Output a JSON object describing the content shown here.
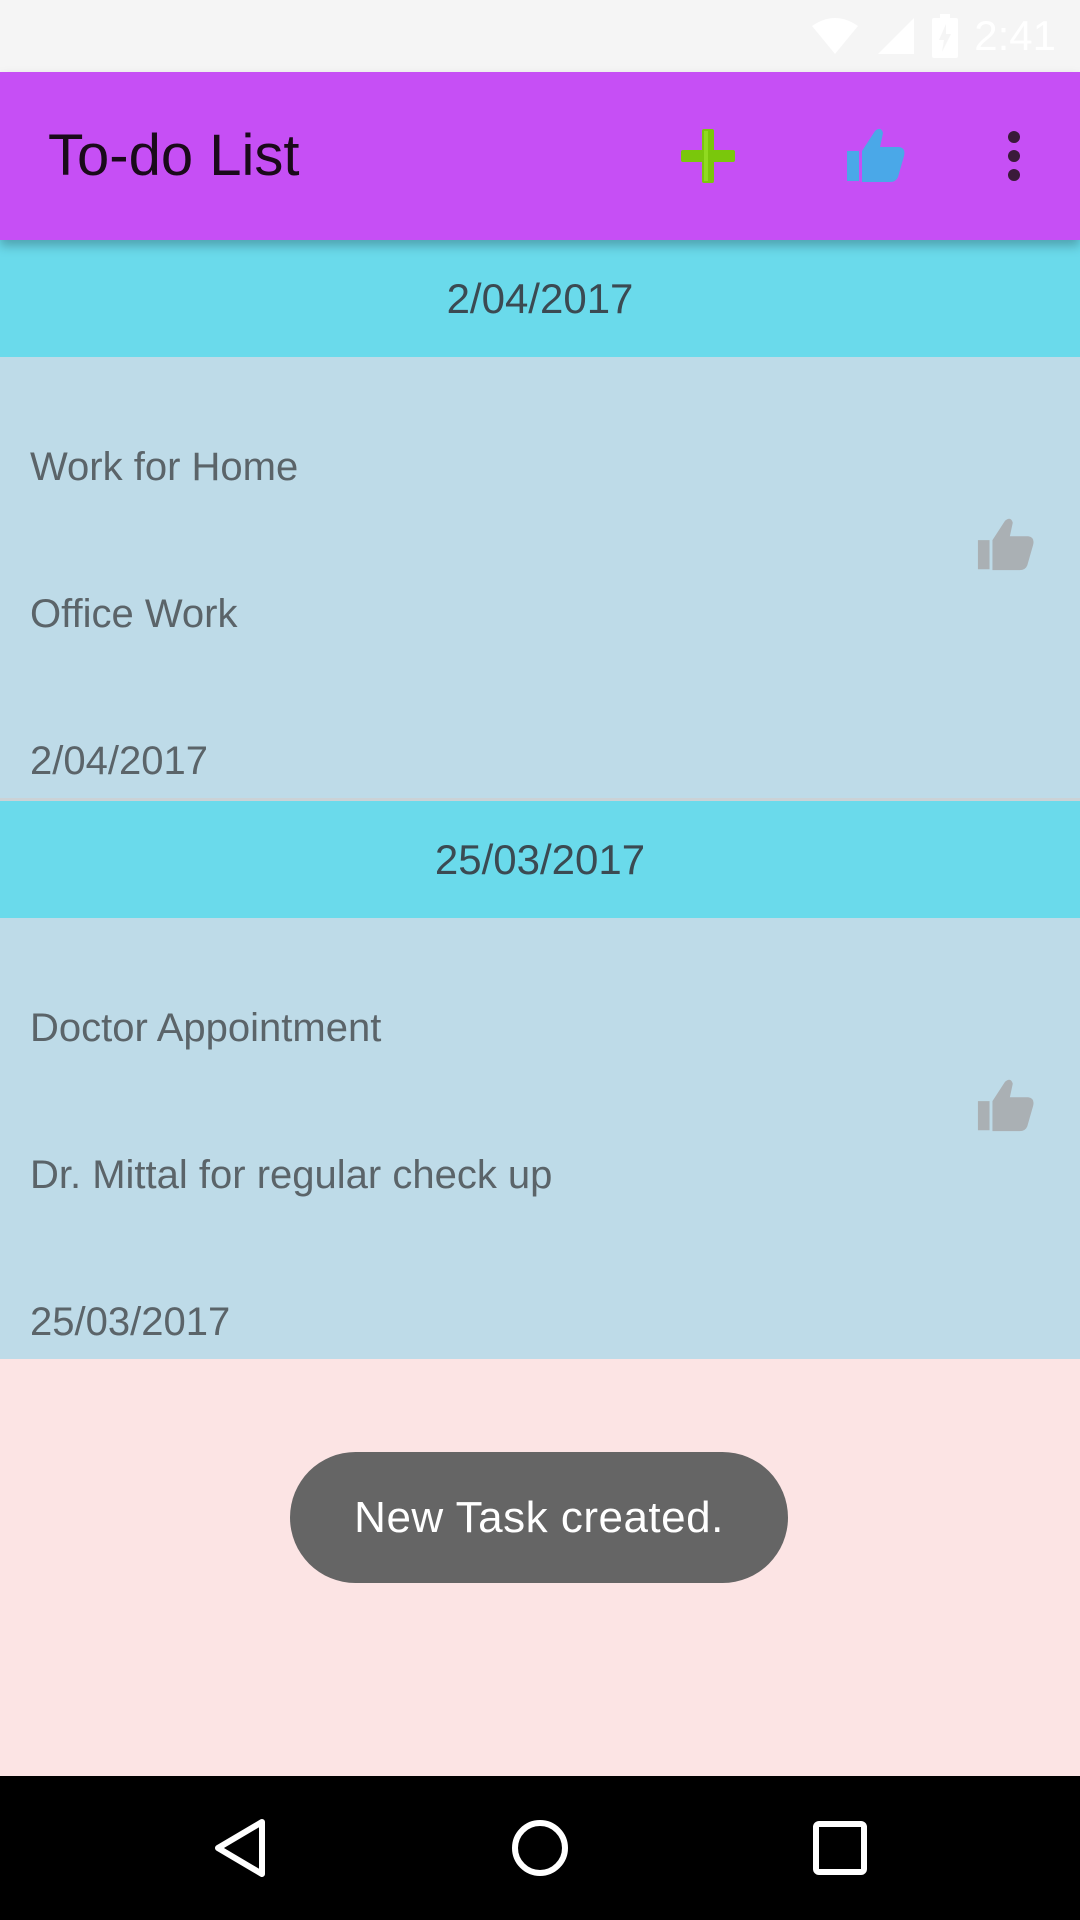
{
  "status_bar": {
    "time": "2:41",
    "icons": [
      "wifi-icon",
      "signal-icon",
      "battery-icon"
    ]
  },
  "app_bar": {
    "title": "To-do List",
    "actions": [
      {
        "name": "add-task-button",
        "icon": "plus-icon",
        "color": "#7ac70c"
      },
      {
        "name": "completed-tasks-button",
        "icon": "thumbs-up-icon",
        "color": "#4aa8e8"
      },
      {
        "name": "overflow-menu-button",
        "icon": "more-vert-icon",
        "color": "#3a1a3a"
      }
    ]
  },
  "sections": [
    {
      "header": "2/04/2017",
      "tasks": [
        {
          "title": "Work for Home",
          "description": "Office Work",
          "date": "2/04/2017",
          "like_icon": "thumbs-up-icon"
        }
      ]
    },
    {
      "header": "25/03/2017",
      "tasks": [
        {
          "title": "Doctor Appointment",
          "description": "Dr. Mittal for regular check up",
          "date": "25/03/2017",
          "like_icon": "thumbs-up-icon"
        }
      ]
    }
  ],
  "toast": {
    "message": "New Task created."
  },
  "nav_bar": {
    "buttons": [
      "back-icon",
      "home-icon",
      "recents-icon"
    ]
  },
  "colors": {
    "app_bar": "#c64ff5",
    "section_header": "#6adaeb",
    "card": "#bedbe8",
    "background": "#fce4e4",
    "toast": "#656565"
  }
}
